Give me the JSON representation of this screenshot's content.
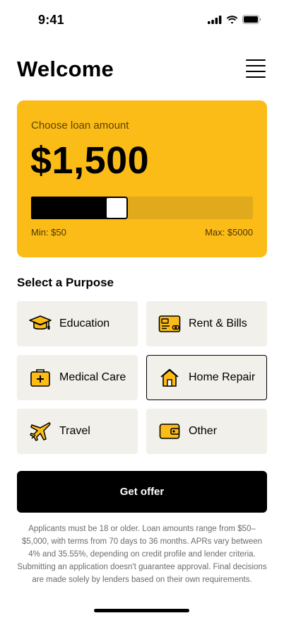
{
  "status_bar": {
    "time": "9:41"
  },
  "header": {
    "title": "Welcome"
  },
  "loan": {
    "label": "Choose loan amount",
    "amount": "$1,500",
    "slider_fraction": 0.34,
    "min_label": "Min: $50",
    "max_label": "Max: $5000"
  },
  "purpose": {
    "title": "Select a Purpose",
    "options": [
      {
        "label": "Education",
        "icon": "graduation-cap-icon",
        "selected": false
      },
      {
        "label": "Rent & Bills",
        "icon": "bill-card-icon",
        "selected": false
      },
      {
        "label": "Medical Care",
        "icon": "medical-kit-icon",
        "selected": false
      },
      {
        "label": "Home Repair",
        "icon": "house-icon",
        "selected": true
      },
      {
        "label": "Travel",
        "icon": "airplane-icon",
        "selected": false
      },
      {
        "label": "Other",
        "icon": "wallet-icon",
        "selected": false
      }
    ]
  },
  "cta": {
    "label": "Get offer"
  },
  "disclaimer": "Applicants must be 18 or older. Loan amounts range from $50–$5,000, with terms from 70 days to 36 months. APRs vary between 4% and 35.55%, depending on credit profile and lender criteria. Submitting an application doesn't guarantee approval. Final decisions are made solely by lenders based on their own requirements.",
  "colors": {
    "accent": "#fbbc18",
    "tile_bg": "#f1f0ea",
    "slider_track": "#e0aa1c"
  }
}
